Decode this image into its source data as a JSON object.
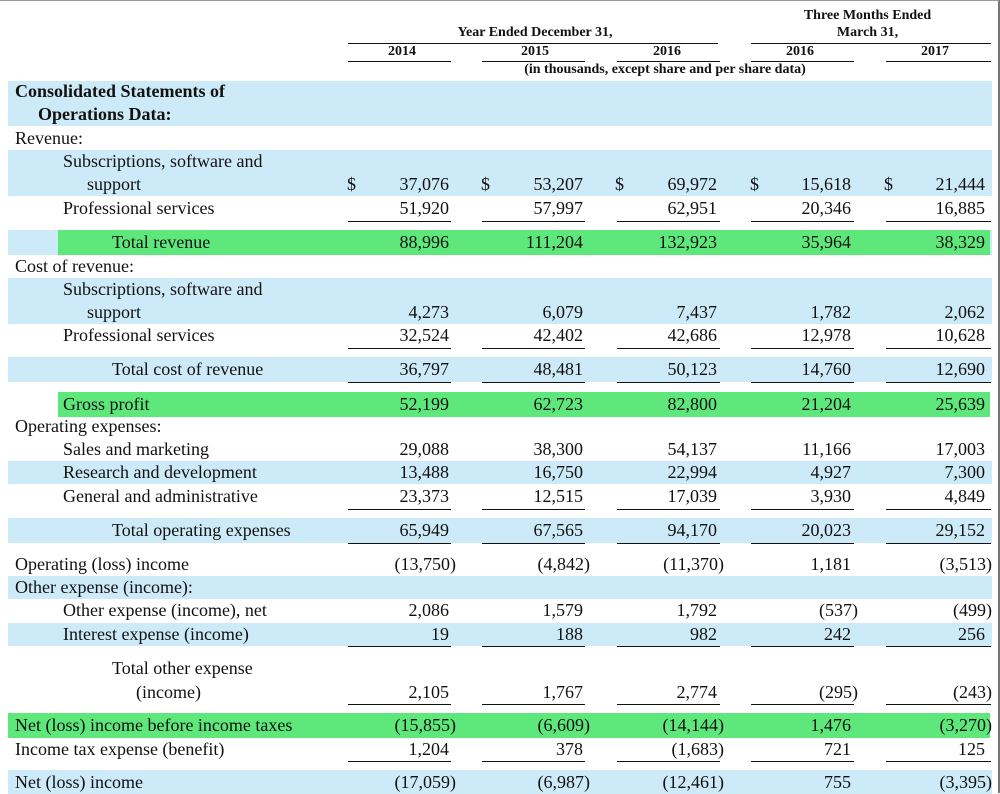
{
  "header": {
    "year_ended": "Year Ended December 31,",
    "three_months_line1": "Three Months Ended",
    "three_months_line2": "March  31,",
    "years": [
      "2014",
      "2015",
      "2016",
      "2016",
      "2017"
    ],
    "units_note": "(in thousands, except share and per share data)"
  },
  "section_title_line1": "Consolidated Statements of",
  "section_title_line2": "Operations Data:",
  "revenue": {
    "label": "Revenue:",
    "subs_line1": "Subscriptions, software and",
    "subs_line2": "support",
    "subs_values": [
      "37,076",
      "53,207",
      "69,972",
      "15,618",
      "21,444"
    ],
    "currency_symbol": "$",
    "prof_label": "Professional services",
    "prof_values": [
      "51,920",
      "57,997",
      "62,951",
      "20,346",
      "16,885"
    ],
    "total_label": "Total revenue",
    "total_values": [
      "88,996",
      "111,204",
      "132,923",
      "35,964",
      "38,329"
    ]
  },
  "cost": {
    "label": "Cost of revenue:",
    "subs_line1": "Subscriptions, software and",
    "subs_line2": "support",
    "subs_values": [
      "4,273",
      "6,079",
      "7,437",
      "1,782",
      "2,062"
    ],
    "prof_label": "Professional services",
    "prof_values": [
      "32,524",
      "42,402",
      "42,686",
      "12,978",
      "10,628"
    ],
    "total_label": "Total cost of revenue",
    "total_values": [
      "36,797",
      "48,481",
      "50,123",
      "14,760",
      "12,690"
    ]
  },
  "gross": {
    "label": "Gross profit",
    "values": [
      "52,199",
      "62,723",
      "82,800",
      "21,204",
      "25,639"
    ]
  },
  "opex": {
    "label": "Operating expenses:",
    "sales_label": "Sales and marketing",
    "sales_values": [
      "29,088",
      "38,300",
      "54,137",
      "11,166",
      "17,003"
    ],
    "rd_label": "Research and development",
    "rd_values": [
      "13,488",
      "16,750",
      "22,994",
      "4,927",
      "7,300"
    ],
    "ga_label": "General and administrative",
    "ga_values": [
      "23,373",
      "12,515",
      "17,039",
      "3,930",
      "4,849"
    ],
    "total_label": "Total operating expenses",
    "total_values": [
      "65,949",
      "67,565",
      "94,170",
      "20,023",
      "29,152"
    ]
  },
  "op_income": {
    "label": "Operating (loss) income",
    "values": [
      "(13,750)",
      "(4,842)",
      "(11,370)",
      "1,181",
      "(3,513)"
    ]
  },
  "other": {
    "label": "Other expense (income):",
    "net_label": "Other expense (income), net",
    "net_values": [
      "2,086",
      "1,579",
      "1,792",
      "(537)",
      "(499)"
    ],
    "interest_label": "Interest expense (income)",
    "interest_values": [
      "19",
      "188",
      "982",
      "242",
      "256"
    ],
    "total_line1": "Total other expense",
    "total_line2": "(income)",
    "total_values": [
      "2,105",
      "1,767",
      "2,774",
      "(295)",
      "(243)"
    ]
  },
  "pretax": {
    "label": "Net (loss) income before income taxes",
    "values": [
      "(15,855)",
      "(6,609)",
      "(14,144)",
      "1,476",
      "(3,270)"
    ]
  },
  "tax": {
    "label": "Income tax expense (benefit)",
    "values": [
      "1,204",
      "378",
      "(1,683)",
      "721",
      "125"
    ]
  },
  "net": {
    "label": "Net (loss) income",
    "values": [
      "(17,059)",
      "(6,987)",
      "(12,461)",
      "755",
      "(3,395)"
    ]
  },
  "colors": {
    "blue_band": "#cdeaf8",
    "green_highlight": "#5ee87b"
  }
}
